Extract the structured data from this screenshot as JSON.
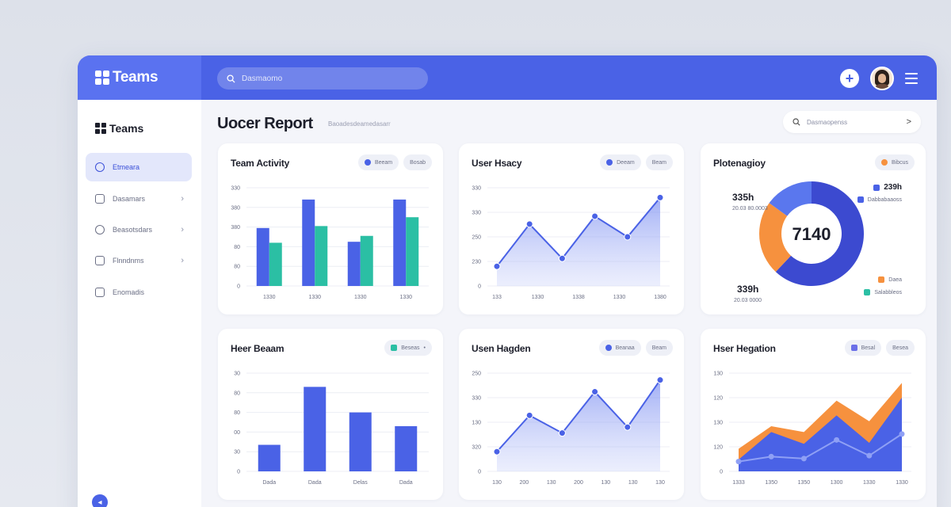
{
  "app": {
    "name": "Teams"
  },
  "search": {
    "placeholder": "Dasmaomo"
  },
  "sidebar": {
    "brand": "Teams",
    "items": [
      {
        "label": "Etmeara",
        "icon": "dashboard-icon",
        "active": true,
        "chevron": false
      },
      {
        "label": "Dasamars",
        "icon": "folder-icon",
        "active": false,
        "chevron": true
      },
      {
        "label": "Beasotsdars",
        "icon": "chart-icon",
        "active": false,
        "chevron": true
      },
      {
        "label": "Flnndnms",
        "icon": "home-icon",
        "active": false,
        "chevron": true
      },
      {
        "label": "Enomadis",
        "icon": "document-icon",
        "active": false,
        "chevron": false
      }
    ],
    "help_icon": "help-icon"
  },
  "header": {
    "title": "Uocer Report",
    "subtitle": "Baoadesdeamedasarr",
    "filter_placeholder": "Dasmaopenss",
    "filter_arrow": ">"
  },
  "colors": {
    "primary": "#4a62e6",
    "teal": "#2bbfa4",
    "orange": "#f6913e",
    "navy": "#3c4ad0",
    "periwinkle": "#5a77ee"
  },
  "cards": [
    {
      "title": "Team Activity",
      "pills": [
        {
          "label": "Beeam",
          "color": "#4a62e6"
        },
        {
          "label": "Bosab"
        }
      ]
    },
    {
      "title": "User Hsacy",
      "pills": [
        {
          "label": "Deeam",
          "color": "#4a62e6"
        },
        {
          "label": "Beam"
        }
      ]
    },
    {
      "title": "Plotenagioy",
      "pills": [
        {
          "label": "Bibcus",
          "color": "#f6913e"
        }
      ]
    },
    {
      "title": "Heer Beaam",
      "pills": [
        {
          "label": "Beseas",
          "color": "#2bbfa4"
        }
      ]
    },
    {
      "title": "Usen Hagden",
      "pills": [
        {
          "label": "Beanaa",
          "color": "#4a62e6"
        },
        {
          "label": "Beam"
        }
      ]
    },
    {
      "title": "Hser Hegation",
      "pills": [
        {
          "label": "Besal",
          "color": "#6b6fe8"
        },
        {
          "label": "Besea"
        }
      ]
    }
  ],
  "donut_legend": {
    "top_value": "239h",
    "top_label": "Dabbabaaoss",
    "bottom_items": [
      {
        "label": "Daea",
        "color": "#f6913e"
      },
      {
        "label": "Salabbleos",
        "color": "#2bbfa4"
      }
    ]
  },
  "chart_data": [
    {
      "type": "bar",
      "title": "Team Activity",
      "y_ticks": [
        "0",
        "80",
        "80",
        "380",
        "380",
        "330"
      ],
      "categories": [
        "1330",
        "1330",
        "1330",
        "1330"
      ],
      "series": [
        {
          "color": "#4a62e6",
          "values": [
            59,
            88,
            45,
            88
          ]
        },
        {
          "color": "#2bbfa4",
          "values": [
            44,
            61,
            51,
            70
          ]
        }
      ],
      "ylim": [
        0,
        100
      ]
    },
    {
      "type": "area",
      "title": "User Hsacy",
      "y_ticks": [
        "0",
        "230",
        "250",
        "330",
        "330"
      ],
      "categories": [
        "133",
        "1330",
        "1338",
        "1330",
        "1380"
      ],
      "x": [
        0,
        1,
        2,
        3,
        4,
        5,
        6
      ],
      "values": [
        20,
        63,
        28,
        71,
        50,
        90
      ],
      "ylim": [
        0,
        100
      ]
    },
    {
      "type": "pie",
      "title": "Plotenagioy",
      "center_label": "7140",
      "callouts": [
        {
          "value": "335h",
          "sub": "20.03 80.0003"
        },
        {
          "value": "339h",
          "sub": "20.03 0000"
        }
      ],
      "slices": [
        {
          "value": 62,
          "color": "#3c4ad0"
        },
        {
          "value": 23,
          "color": "#f6913e"
        },
        {
          "value": 15,
          "color": "#5a77ee"
        }
      ]
    },
    {
      "type": "bar",
      "title": "Heer Beaam",
      "y_ticks": [
        "0",
        "30",
        "00",
        "80",
        "80",
        "30"
      ],
      "categories": [
        "Dada",
        "Dada",
        "Delas",
        "Dada"
      ],
      "series": [
        {
          "color": "#4a62e6",
          "values": [
            27,
            86,
            60,
            46
          ]
        }
      ],
      "ylim": [
        0,
        100
      ]
    },
    {
      "type": "area",
      "title": "Usen Hagden",
      "y_ticks": [
        "0",
        "320",
        "130",
        "330",
        "250"
      ],
      "categories": [
        "130",
        "200",
        "130",
        "200",
        "130",
        "130",
        "130"
      ],
      "values": [
        20,
        57,
        39,
        81,
        45,
        93
      ],
      "ylim": [
        0,
        100
      ]
    },
    {
      "type": "area",
      "title": "Hser Hegation",
      "y_ticks": [
        "0",
        "120",
        "130",
        "120",
        "130"
      ],
      "categories": [
        "1333",
        "1350",
        "1350",
        "1300",
        "1330",
        "1330"
      ],
      "series": [
        {
          "color": "#f6913e",
          "values": [
            23,
            46,
            40,
            72,
            51,
            90
          ]
        },
        {
          "color": "#4a62e6",
          "values": [
            12,
            40,
            28,
            57,
            29,
            75
          ]
        },
        {
          "color": "#5a77ee",
          "line": true,
          "values": [
            10,
            15,
            13,
            32,
            16,
            38
          ]
        }
      ],
      "ylim": [
        0,
        100
      ]
    }
  ]
}
